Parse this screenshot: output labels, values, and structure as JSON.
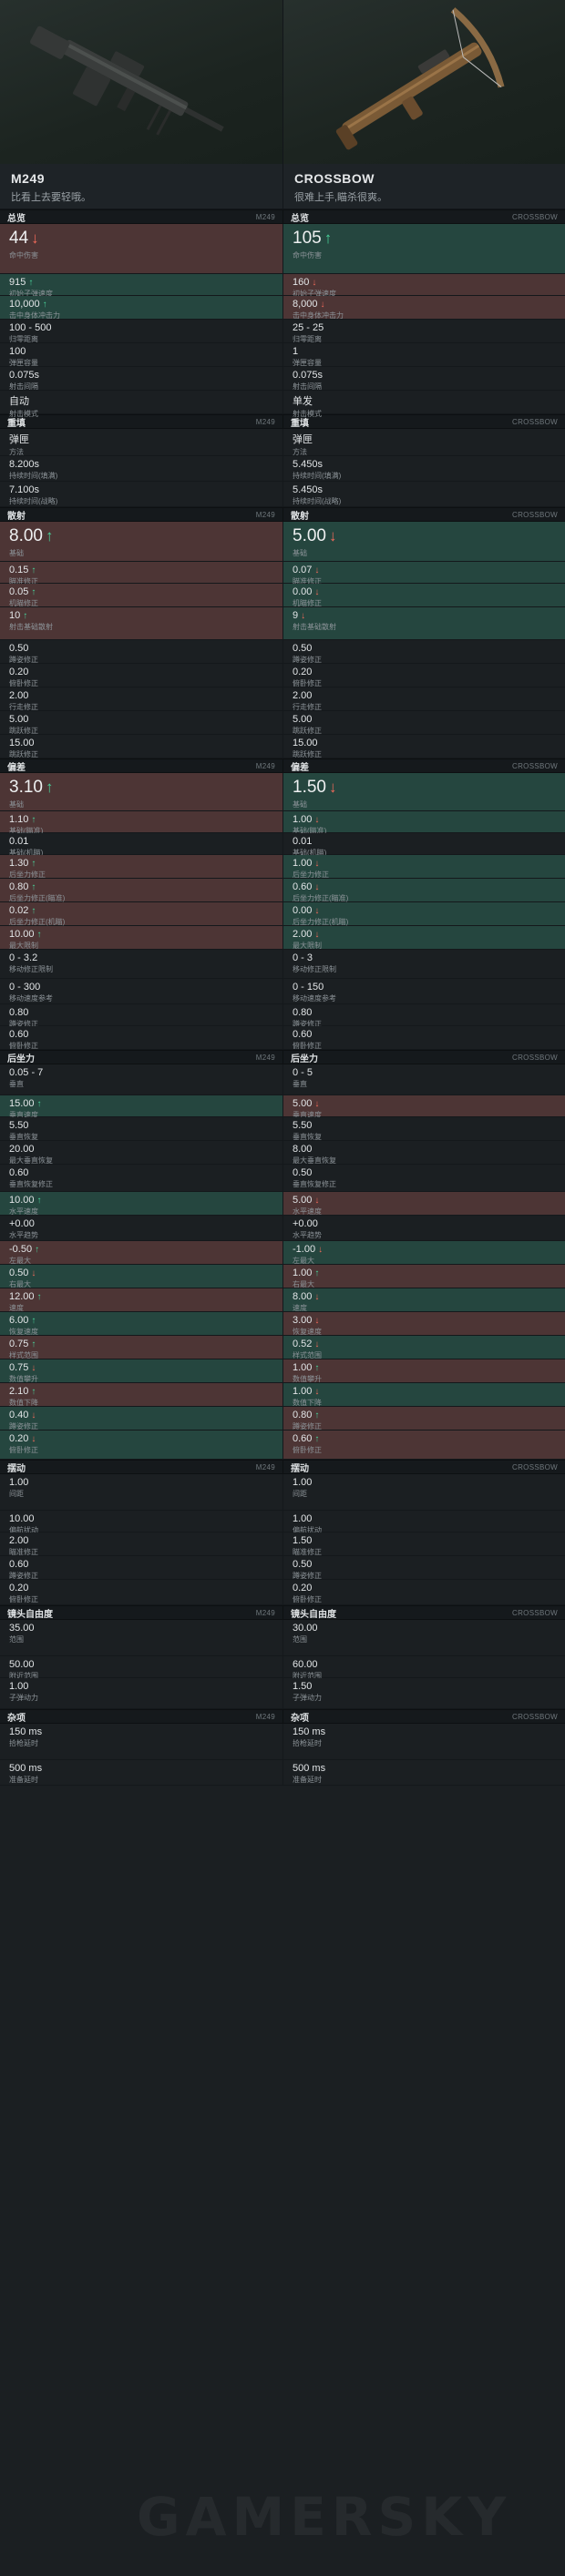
{
  "weapons": [
    {
      "name": "M249",
      "desc": "比看上去要轻哦。",
      "tag": "M249"
    },
    {
      "name": "CROSSBOW",
      "desc": "很难上手,瞄杀很爽。",
      "tag": "CROSSBOW"
    }
  ],
  "colors": {
    "better": "#25463f",
    "worse": "#4d3535",
    "up_arrow": "#49d29a",
    "down_arrow": "#f06a5a"
  },
  "watermark": "GAMERSKY",
  "sections": [
    {
      "title": "总览",
      "rows": [
        {
          "big": true,
          "h": 55,
          "a": {
            "v": "44",
            "arrow": "down",
            "hl": "down",
            "l": "命中伤害"
          },
          "b": {
            "v": "105",
            "arrow": "up",
            "hl": "up",
            "l": "命中伤害"
          }
        },
        {
          "h": 24,
          "a": {
            "v": "915",
            "arrow": "up",
            "hl": "up",
            "l": "初始子弹速度"
          },
          "b": {
            "v": "160",
            "arrow": "down",
            "hl": "down",
            "l": "初始子弹速度"
          }
        },
        {
          "h": 26,
          "a": {
            "v": "10,000",
            "arrow": "up",
            "hl": "up",
            "l": "击中身体冲击力"
          },
          "b": {
            "v": "8,000",
            "arrow": "down",
            "hl": "down",
            "l": "击中身体冲击力"
          }
        },
        {
          "h": 26,
          "a": {
            "v": "100 - 500",
            "l": "归零距离"
          },
          "b": {
            "v": "25 - 25",
            "l": "归零距离"
          }
        },
        {
          "h": 26,
          "a": {
            "v": "100",
            "l": "弹匣容量"
          },
          "b": {
            "v": "1",
            "l": "弹匣容量"
          }
        },
        {
          "h": 26,
          "a": {
            "v": "0.075s",
            "l": "射击间隔"
          },
          "b": {
            "v": "0.075s",
            "l": "射击间隔"
          }
        },
        {
          "h": 26,
          "a": {
            "v": "自动",
            "l": "射击模式"
          },
          "b": {
            "v": "单发",
            "l": "射击模式"
          }
        }
      ]
    },
    {
      "title": "重填",
      "rows": [
        {
          "h": 30,
          "a": {
            "v": "弹匣",
            "l": "方法"
          },
          "b": {
            "v": "弹匣",
            "l": "方法"
          }
        },
        {
          "h": 28,
          "a": {
            "v": "8.200s",
            "l": "持续时间(填满)"
          },
          "b": {
            "v": "5.450s",
            "l": "持续时间(填满)"
          }
        },
        {
          "h": 28,
          "a": {
            "v": "7.100s",
            "l": "持续时间(战略)"
          },
          "b": {
            "v": "5.450s",
            "l": "持续时间(战略)"
          }
        }
      ]
    },
    {
      "title": "散射",
      "rows": [
        {
          "big": true,
          "h": 44,
          "a": {
            "v": "8.00",
            "arrow": "up",
            "hl": "down",
            "l": "基础"
          },
          "b": {
            "v": "5.00",
            "arrow": "down",
            "hl": "up",
            "l": "基础"
          }
        },
        {
          "h": 24,
          "a": {
            "v": "0.15",
            "arrow": "up",
            "hl": "down",
            "l": "瞄准修正"
          },
          "b": {
            "v": "0.07",
            "arrow": "down",
            "hl": "up",
            "l": "瞄准修正"
          }
        },
        {
          "h": 26,
          "a": {
            "v": "0.05",
            "arrow": "up",
            "hl": "down",
            "l": "机瞄修正"
          },
          "b": {
            "v": "0.00",
            "arrow": "down",
            "hl": "up",
            "l": "机瞄修正"
          }
        },
        {
          "h": 36,
          "a": {
            "v": "10",
            "arrow": "up",
            "hl": "down",
            "l": "射击基础散射"
          },
          "b": {
            "v": "9",
            "arrow": "down",
            "hl": "up",
            "l": "射击基础散射"
          }
        },
        {
          "h": 26,
          "a": {
            "v": "0.50",
            "l": "蹲姿修正"
          },
          "b": {
            "v": "0.50",
            "l": "蹲姿修正"
          }
        },
        {
          "h": 26,
          "a": {
            "v": "0.20",
            "l": "俯卧修正"
          },
          "b": {
            "v": "0.20",
            "l": "俯卧修正"
          }
        },
        {
          "h": 26,
          "a": {
            "v": "2.00",
            "l": "行走修正"
          },
          "b": {
            "v": "2.00",
            "l": "行走修正"
          }
        },
        {
          "h": 26,
          "a": {
            "v": "5.00",
            "l": "跳跃修正"
          },
          "b": {
            "v": "5.00",
            "l": "跳跃修正"
          }
        },
        {
          "h": 26,
          "a": {
            "v": "15.00",
            "l": "跳跃修正"
          },
          "b": {
            "v": "15.00",
            "l": "跳跃修正"
          }
        }
      ]
    },
    {
      "title": "偏差",
      "rows": [
        {
          "big": true,
          "h": 42,
          "a": {
            "v": "3.10",
            "arrow": "up",
            "hl": "down",
            "l": "基础"
          },
          "b": {
            "v": "1.50",
            "arrow": "down",
            "hl": "up",
            "l": "基础"
          }
        },
        {
          "h": 24,
          "a": {
            "v": "1.10",
            "arrow": "up",
            "hl": "down",
            "l": "基础(瞄准)"
          },
          "b": {
            "v": "1.00",
            "arrow": "down",
            "hl": "up",
            "l": "基础(瞄准)"
          }
        },
        {
          "h": 24,
          "a": {
            "v": "0.01",
            "l": "基础(机瞄)"
          },
          "b": {
            "v": "0.01",
            "l": "基础(机瞄)"
          }
        },
        {
          "h": 26,
          "a": {
            "v": "1.30",
            "arrow": "up",
            "hl": "down",
            "l": "后坐力修正"
          },
          "b": {
            "v": "1.00",
            "arrow": "down",
            "hl": "up",
            "l": "后坐力修正"
          }
        },
        {
          "h": 26,
          "a": {
            "v": "0.80",
            "arrow": "up",
            "hl": "down",
            "l": "后坐力修正(瞄准)"
          },
          "b": {
            "v": "0.60",
            "arrow": "down",
            "hl": "up",
            "l": "后坐力修正(瞄准)"
          }
        },
        {
          "h": 26,
          "a": {
            "v": "0.02",
            "arrow": "up",
            "hl": "down",
            "l": "后坐力修正(机瞄)"
          },
          "b": {
            "v": "0.00",
            "arrow": "down",
            "hl": "up",
            "l": "后坐力修正(机瞄)"
          }
        },
        {
          "h": 26,
          "a": {
            "v": "10.00",
            "arrow": "up",
            "hl": "down",
            "l": "最大限制"
          },
          "b": {
            "v": "2.00",
            "arrow": "down",
            "hl": "up",
            "l": "最大限制"
          }
        },
        {
          "h": 32,
          "a": {
            "v": "0 - 3.2",
            "l": "移动修正限制"
          },
          "b": {
            "v": "0 - 3",
            "l": "移动修正限制"
          }
        },
        {
          "h": 28,
          "a": {
            "v": "0 - 300",
            "l": "移动速度参考"
          },
          "b": {
            "v": "0 - 150",
            "l": "移动速度参考"
          }
        },
        {
          "h": 24,
          "a": {
            "v": "0.80",
            "l": "蹲姿修正"
          },
          "b": {
            "v": "0.80",
            "l": "蹲姿修正"
          }
        },
        {
          "h": 26,
          "a": {
            "v": "0.60",
            "l": "俯卧修正"
          },
          "b": {
            "v": "0.60",
            "l": "俯卧修正"
          }
        }
      ]
    },
    {
      "title": "后坐力",
      "rows": [
        {
          "h": 34,
          "a": {
            "v": "0.05 - 7",
            "l": "垂直"
          },
          "b": {
            "v": "0 - 5",
            "l": "垂直"
          }
        },
        {
          "h": 24,
          "a": {
            "v": "15.00",
            "arrow": "up",
            "hl": "up",
            "l": "垂直速度"
          },
          "b": {
            "v": "5.00",
            "arrow": "down",
            "hl": "down",
            "l": "垂直速度"
          }
        },
        {
          "h": 26,
          "a": {
            "v": "5.50",
            "l": "垂直恢复"
          },
          "b": {
            "v": "5.50",
            "l": "垂直恢复"
          }
        },
        {
          "h": 26,
          "a": {
            "v": "20.00",
            "l": "最大垂直恢复"
          },
          "b": {
            "v": "8.00",
            "l": "最大垂直恢复"
          }
        },
        {
          "h": 30,
          "a": {
            "v": "0.60",
            "l": "垂直恢复修正"
          },
          "b": {
            "v": "0.50",
            "l": "垂直恢复修正"
          }
        },
        {
          "h": 26,
          "a": {
            "v": "10.00",
            "arrow": "up",
            "hl": "up",
            "l": "水平速度"
          },
          "b": {
            "v": "5.00",
            "arrow": "down",
            "hl": "down",
            "l": "水平速度"
          }
        },
        {
          "h": 28,
          "a": {
            "v": "+0.00",
            "l": "水平趋势"
          },
          "b": {
            "v": "+0.00",
            "l": "水平趋势"
          }
        },
        {
          "h": 26,
          "a": {
            "v": "-0.50",
            "arrow": "up",
            "hl": "down",
            "l": "左最大"
          },
          "b": {
            "v": "-1.00",
            "arrow": "down",
            "hl": "up",
            "l": "左最大"
          }
        },
        {
          "h": 26,
          "a": {
            "v": "0.50",
            "arrow": "down",
            "hl": "up",
            "l": "右最大"
          },
          "b": {
            "v": "1.00",
            "arrow": "up",
            "hl": "down",
            "l": "右最大"
          }
        },
        {
          "h": 26,
          "a": {
            "v": "12.00",
            "arrow": "up",
            "hl": "down",
            "l": "速度"
          },
          "b": {
            "v": "8.00",
            "arrow": "down",
            "hl": "up",
            "l": "速度"
          }
        },
        {
          "h": 26,
          "a": {
            "v": "6.00",
            "arrow": "up",
            "hl": "up",
            "l": "恢复速度"
          },
          "b": {
            "v": "3.00",
            "arrow": "down",
            "hl": "down",
            "l": "恢复速度"
          }
        },
        {
          "h": 26,
          "a": {
            "v": "0.75",
            "arrow": "up",
            "hl": "down",
            "l": "样式范围"
          },
          "b": {
            "v": "0.52",
            "arrow": "down",
            "hl": "up",
            "l": "样式范围"
          }
        },
        {
          "h": 26,
          "a": {
            "v": "0.75",
            "arrow": "down",
            "hl": "up",
            "l": "数值攀升"
          },
          "b": {
            "v": "1.00",
            "arrow": "up",
            "hl": "down",
            "l": "数值攀升"
          }
        },
        {
          "h": 26,
          "a": {
            "v": "2.10",
            "arrow": "up",
            "hl": "down",
            "l": "数值下降"
          },
          "b": {
            "v": "1.00",
            "arrow": "down",
            "hl": "up",
            "l": "数值下降"
          }
        },
        {
          "h": 26,
          "a": {
            "v": "0.40",
            "arrow": "down",
            "hl": "up",
            "l": "蹲姿修正"
          },
          "b": {
            "v": "0.80",
            "arrow": "up",
            "hl": "down",
            "l": "蹲姿修正"
          }
        },
        {
          "h": 32,
          "a": {
            "v": "0.20",
            "arrow": "down",
            "hl": "up",
            "l": "俯卧修正"
          },
          "b": {
            "v": "0.60",
            "arrow": "up",
            "hl": "down",
            "l": "俯卧修正"
          }
        }
      ]
    },
    {
      "title": "摆动",
      "rows": [
        {
          "h": 40,
          "a": {
            "v": "1.00",
            "l": "间距"
          },
          "b": {
            "v": "1.00",
            "l": "间距"
          }
        },
        {
          "h": 24,
          "a": {
            "v": "10.00",
            "l": "偏航扰动"
          },
          "b": {
            "v": "1.00",
            "l": "偏航扰动"
          }
        },
        {
          "h": 26,
          "a": {
            "v": "2.00",
            "l": "瞄准修正"
          },
          "b": {
            "v": "1.50",
            "l": "瞄准修正"
          }
        },
        {
          "h": 26,
          "a": {
            "v": "0.60",
            "l": "蹲姿修正"
          },
          "b": {
            "v": "0.50",
            "l": "蹲姿修正"
          }
        },
        {
          "h": 28,
          "a": {
            "v": "0.20",
            "l": "俯卧修正"
          },
          "b": {
            "v": "0.20",
            "l": "俯卧修正"
          }
        }
      ]
    },
    {
      "title": "镜头自由度",
      "rows": [
        {
          "h": 40,
          "a": {
            "v": "35.00",
            "l": "范围"
          },
          "b": {
            "v": "30.00",
            "l": "范围"
          }
        },
        {
          "h": 24,
          "a": {
            "v": "50.00",
            "l": "附近范围"
          },
          "b": {
            "v": "60.00",
            "l": "附近范围"
          }
        },
        {
          "h": 34,
          "a": {
            "v": "1.00",
            "l": "子弹动力"
          },
          "b": {
            "v": "1.50",
            "l": "子弹动力"
          }
        }
      ]
    },
    {
      "title": "杂项",
      "rows": [
        {
          "h": 40,
          "a": {
            "v": "150 ms",
            "l": "拾枪延时"
          },
          "b": {
            "v": "150 ms",
            "l": "拾枪延时"
          }
        },
        {
          "h": 28,
          "a": {
            "v": "500 ms",
            "l": "准备延时"
          },
          "b": {
            "v": "500 ms",
            "l": "准备延时"
          }
        }
      ]
    }
  ]
}
